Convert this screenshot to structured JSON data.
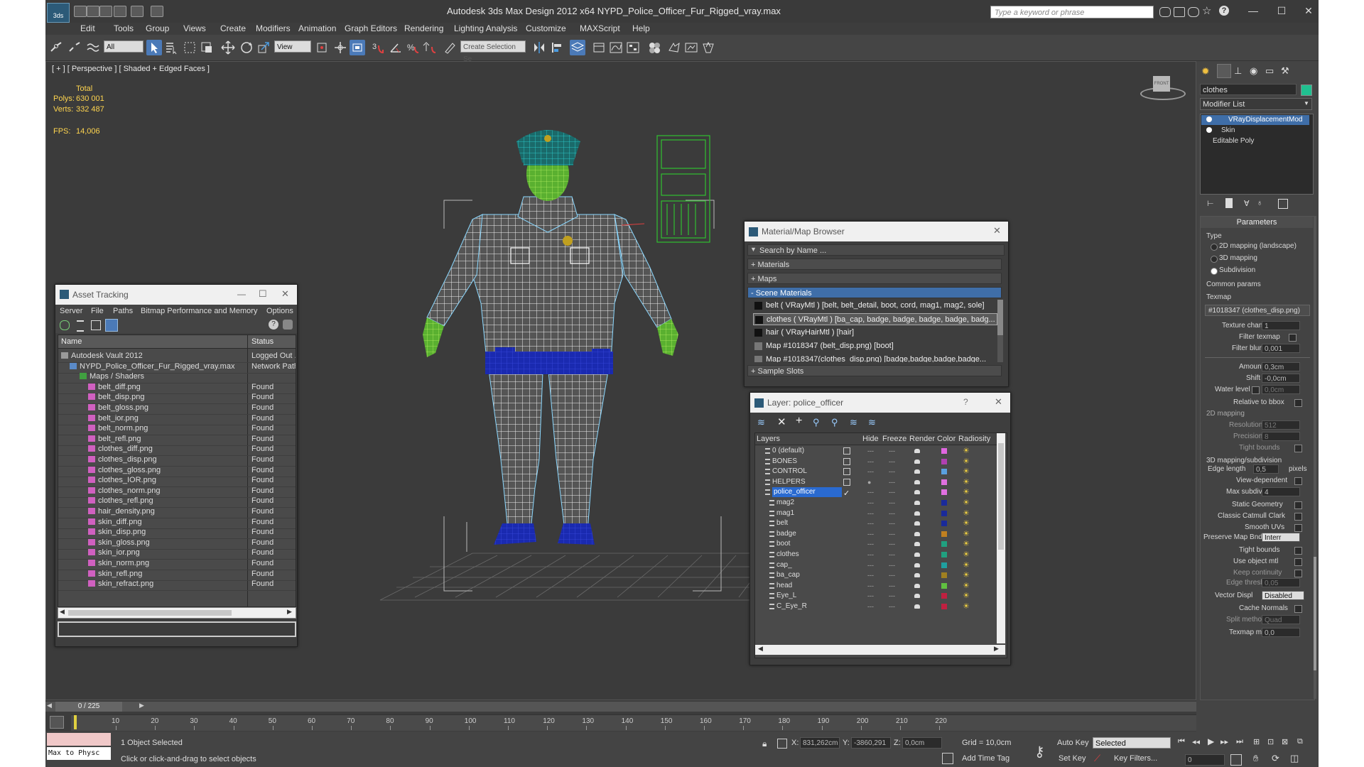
{
  "app": {
    "title": "Autodesk 3ds Max Design 2012 x64      NYPD_Police_Officer_Fur_Rigged_vray.max",
    "search_placeholder": "Type a keyword or phrase"
  },
  "menu": [
    "Edit",
    "Tools",
    "Group",
    "Views",
    "Create",
    "Modifiers",
    "Animation",
    "Graph Editors",
    "Rendering",
    "Lighting Analysis",
    "Customize",
    "MAXScript",
    "Help"
  ],
  "toolbar": {
    "selection_filter": "All",
    "ref_coord": "View",
    "named_selection": "Create Selection Se"
  },
  "viewport": {
    "label": "[ + ] [ Perspective ] [ Shaded + Edged Faces ]",
    "stats_header": "Total",
    "polys_label": "Polys:",
    "polys_value": "630 001",
    "verts_label": "Verts:",
    "verts_value": "332 487",
    "fps_label": "FPS:",
    "fps_value": "14,006",
    "viewcube_label": "FRONT"
  },
  "asset_tracking": {
    "title": "Asset Tracking",
    "menu": [
      "Server",
      "File",
      "Paths",
      "Bitmap Performance and Memory",
      "Options"
    ],
    "col_name": "Name",
    "col_status": "Status",
    "rows": [
      {
        "name": "Autodesk Vault 2012",
        "status": "Logged Out ..."
      },
      {
        "name": "NYPD_Police_Officer_Fur_Rigged_vray.max",
        "status": "Network Path"
      },
      {
        "name": "Maps / Shaders",
        "status": ""
      },
      {
        "name": "belt_diff.png",
        "status": "Found"
      },
      {
        "name": "belt_disp.png",
        "status": "Found"
      },
      {
        "name": "belt_gloss.png",
        "status": "Found"
      },
      {
        "name": "belt_ior.png",
        "status": "Found"
      },
      {
        "name": "belt_norm.png",
        "status": "Found"
      },
      {
        "name": "belt_refl.png",
        "status": "Found"
      },
      {
        "name": "clothes_diff.png",
        "status": "Found"
      },
      {
        "name": "clothes_disp.png",
        "status": "Found"
      },
      {
        "name": "clothes_gloss.png",
        "status": "Found"
      },
      {
        "name": "clothes_IOR.png",
        "status": "Found"
      },
      {
        "name": "clothes_norm.png",
        "status": "Found"
      },
      {
        "name": "clothes_refl.png",
        "status": "Found"
      },
      {
        "name": "hair_density.png",
        "status": "Found"
      },
      {
        "name": "skin_diff.png",
        "status": "Found"
      },
      {
        "name": "skin_disp.png",
        "status": "Found"
      },
      {
        "name": "skin_gloss.png",
        "status": "Found"
      },
      {
        "name": "skin_ior.png",
        "status": "Found"
      },
      {
        "name": "skin_norm.png",
        "status": "Found"
      },
      {
        "name": "skin_refl.png",
        "status": "Found"
      },
      {
        "name": "skin_refract.png",
        "status": "Found"
      }
    ]
  },
  "material_browser": {
    "title": "Material/Map Browser",
    "search_placeholder": "Search by Name ...",
    "groups": [
      "+ Materials",
      "+ Maps",
      "- Scene Materials",
      "+ Sample Slots"
    ],
    "items": [
      "belt  ( VRayMtl ) [belt, belt_detail, boot, cord, mag1, mag2, sole]",
      "clothes  ( VRayMtl ) [ba_cap, badge, badge, badge, badge, badg...",
      "hair  ( VRayHairMtl ) [hair]",
      "Map #1018347 (belt_disp.png) [boot]",
      "Map #1018347(clothes_disp.png) [badge,badge,badge,badge..."
    ]
  },
  "layer_manager": {
    "title": "Layer: police_officer",
    "help": "?",
    "cols": [
      "Layers",
      "Hide",
      "Freeze",
      "Render",
      "Color",
      "Radiosity"
    ],
    "layers": [
      {
        "name": "0 (default)",
        "color": "#e066e0"
      },
      {
        "name": "BONES",
        "color": "#b040b0"
      },
      {
        "name": "CONTROL",
        "color": "#5aa0e0"
      },
      {
        "name": "HELPERS",
        "color": "#e070e0"
      },
      {
        "name": "police_officer",
        "color": "#e070e0"
      },
      {
        "name": "mag2",
        "color": "#1a2a9a"
      },
      {
        "name": "mag1",
        "color": "#1a2a9a"
      },
      {
        "name": "belt",
        "color": "#1a2a9a"
      },
      {
        "name": "badge",
        "color": "#c08020"
      },
      {
        "name": "boot",
        "color": "#20a080"
      },
      {
        "name": "clothes",
        "color": "#20a080"
      },
      {
        "name": "cap_",
        "color": "#20a0a0"
      },
      {
        "name": "ba_cap",
        "color": "#a08020"
      },
      {
        "name": "head",
        "color": "#60c040"
      },
      {
        "name": "Eye_L",
        "color": "#c02040"
      },
      {
        "name": "C_Eye_R",
        "color": "#c02040"
      }
    ]
  },
  "command_panel": {
    "object_name": "clothes",
    "modifier_list": "Modifier List",
    "stack": [
      "VRayDisplacementMod",
      "Skin",
      "Editable Poly"
    ],
    "rollout": "Parameters",
    "type_label": "Type",
    "type_options": [
      "2D mapping (landscape)",
      "3D mapping",
      "Subdivision"
    ],
    "common_params": "Common params",
    "texmap_label": "Texmap",
    "texmap_value": "#1018347 (clothes_disp.png)",
    "texture_chan_label": "Texture chan",
    "texture_chan_value": "1",
    "filter_texmap_label": "Filter texmap",
    "filter_blur_label": "Filter blur",
    "filter_blur_value": "0,001",
    "amount_label": "Amount",
    "amount_value": "0,3cm",
    "shift_label": "Shift",
    "shift_value": "-0,0cm",
    "water_level_label": "Water level",
    "water_level_value": "0,0cm",
    "relative_label": "Relative to bbox",
    "mapping2d_label": "2D mapping",
    "resolution_label": "Resolution",
    "resolution_value": "512",
    "precision_label": "Precision",
    "precision_value": "8",
    "tight_bounds_label": "Tight bounds",
    "mapping3d_label": "3D mapping/subdivision",
    "edge_length_label": "Edge length",
    "edge_length_value": "0,5",
    "pixels_label": "pixels",
    "view_dependent_label": "View-dependent",
    "max_subdivs_label": "Max subdivs",
    "max_subdivs_value": "4",
    "static_geometry_label": "Static Geometry",
    "classic_catmull_label": "Classic Catmull Clark",
    "smooth_uvs_label": "Smooth UVs",
    "preserve_map_label": "Preserve Map Bnd",
    "preserve_map_value": "Interr",
    "tight_bounds2_label": "Tight bounds",
    "use_object_mtl_label": "Use object mtl",
    "keep_continuity_label": "Keep continuity",
    "edge_thresh_label": "Edge thresh",
    "edge_thresh_value": "0,05",
    "vector_displ_label": "Vector Displ",
    "vector_displ_value": "Disabled",
    "cache_normals_label": "Cache Normals",
    "split_method_label": "Split method",
    "split_method_value": "Quad",
    "texmap_min_label": "Texmap min",
    "texmap_min_value": "0,0"
  },
  "timeline": {
    "frame_counter": "0 / 225",
    "ticks": [
      "10",
      "20",
      "30",
      "40",
      "50",
      "60",
      "70",
      "80",
      "90",
      "100",
      "110",
      "120",
      "130",
      "140",
      "150",
      "160",
      "170",
      "180",
      "190",
      "200",
      "210",
      "220"
    ]
  },
  "statusbar": {
    "maxscript": "Max to Physc",
    "selection": "1 Object Selected",
    "prompt": "Click or click-and-drag to select objects",
    "x_label": "X:",
    "x_value": "831,262cm",
    "y_label": "Y:",
    "y_value": "-3860,291",
    "z_label": "Z:",
    "z_value": "0,0cm",
    "grid": "Grid = 10,0cm",
    "add_time_tag": "Add Time Tag",
    "auto_key": "Auto Key",
    "set_key": "Set Key",
    "key_mode": "Selected",
    "key_filters": "Key Filters...",
    "frame": "0"
  }
}
